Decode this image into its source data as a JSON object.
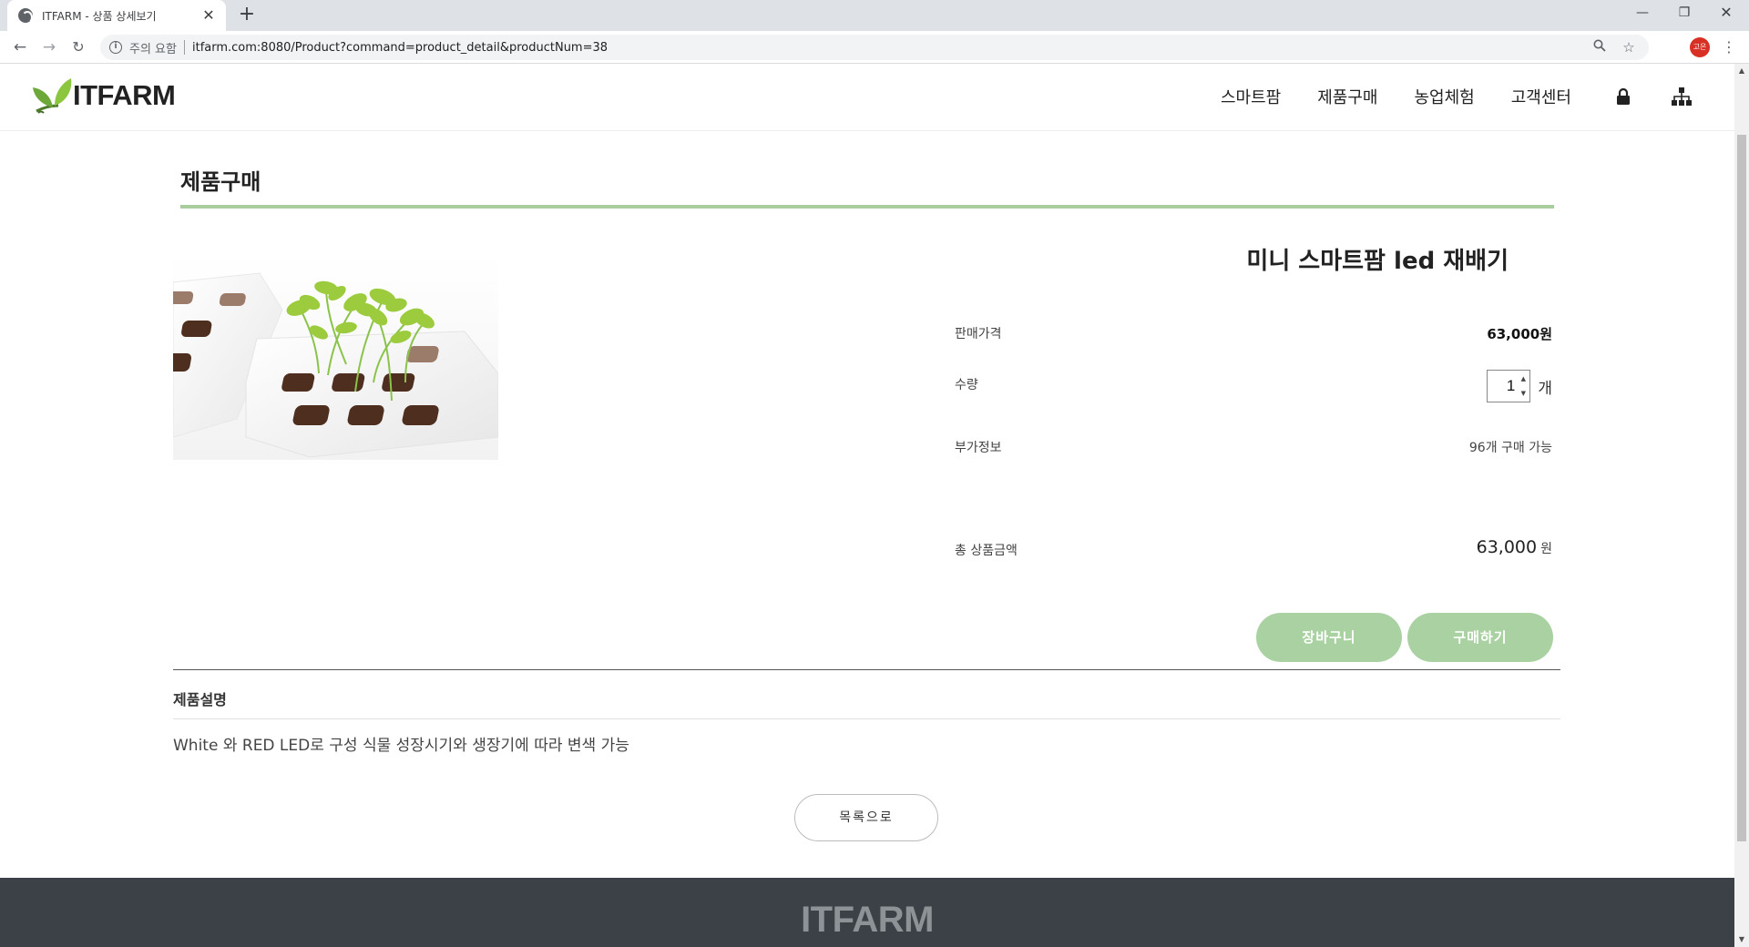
{
  "browser": {
    "tab_title": "ITFARM - 상품 상세보기",
    "tab_close": "✕",
    "new_tab": "+",
    "security_label": "주의 요함",
    "url": "itfarm.com:8080/Product?command=product_detail&productNum=38",
    "profile_initials": "고은",
    "window_controls": {
      "minimize": "—",
      "maximize": "❐",
      "close": "✕"
    },
    "nav": {
      "back": "←",
      "forward": "→",
      "reload": "↻"
    }
  },
  "site": {
    "logo_text": "ITFARM",
    "nav_items": [
      "스마트팜",
      "제품구매",
      "농업체험",
      "고객센터"
    ],
    "icons": [
      "lock-icon",
      "sitemap-icon"
    ]
  },
  "page": {
    "title": "제품구매",
    "accent_color": "#a9cd9c",
    "button_color": "#a9d1a1"
  },
  "product": {
    "name": "미니 스마트팜 led 재배기",
    "price_label": "판매가격",
    "price_value": "63,000원",
    "quantity_label": "수량",
    "quantity_value": "1",
    "quantity_unit": "개",
    "extra_label": "부가정보",
    "extra_value": "96개 구매 가능",
    "total_label": "총 상품금액",
    "total_value": "63,000",
    "total_unit": "원",
    "cart_button": "장바구니",
    "buy_button": "구매하기"
  },
  "description": {
    "heading": "제품설명",
    "text": "White 와 RED LED로 구성 식물 성장시기와 생장기에 따라 변색 가능"
  },
  "list_button": "목록으로",
  "footer": {
    "logo_text": "ITFARM"
  }
}
